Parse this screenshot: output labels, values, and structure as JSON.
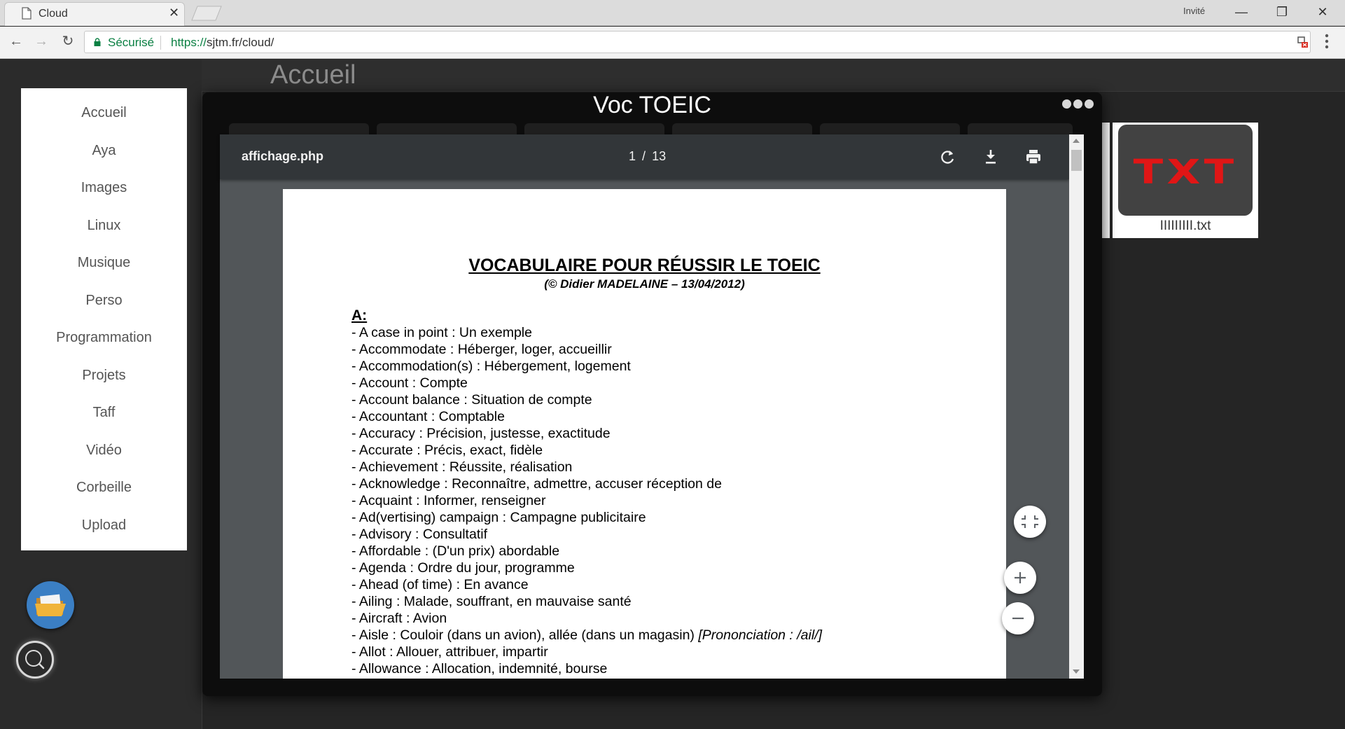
{
  "browser": {
    "tab_title": "Cloud",
    "profile_label": "Invité",
    "secure_label": "Sécurisé",
    "url_scheme": "https://",
    "url_rest": "sjtm.fr/cloud/"
  },
  "page": {
    "title": "Accueil"
  },
  "sidebar": {
    "items": [
      {
        "label": "Accueil"
      },
      {
        "label": "Aya"
      },
      {
        "label": "Images"
      },
      {
        "label": "Linux"
      },
      {
        "label": "Musique"
      },
      {
        "label": "Perso"
      },
      {
        "label": "Programmation"
      },
      {
        "label": "Projets"
      },
      {
        "label": "Taff"
      },
      {
        "label": "Vidéo"
      },
      {
        "label": "Corbeille"
      },
      {
        "label": "Upload"
      }
    ]
  },
  "files": {
    "txt_thumb_label": "TXT",
    "txt_file_name": "IIIIIIIII.txt"
  },
  "modal": {
    "title": "Voc TOEIC"
  },
  "pdf": {
    "filename": "affichage.php",
    "current_page": "1",
    "page_separator": "/",
    "total_pages": "13",
    "doc_title": "VOCABULAIRE POUR RÉUSSIR LE TOEIC",
    "doc_subtitle": "(© Didier MADELAINE – 13/04/2012)",
    "section": "A:",
    "entries": [
      "- A case in point : Un exemple",
      "- Accommodate : Héberger, loger, accueillir",
      "- Accommodation(s) : Hébergement, logement",
      "- Account : Compte",
      "- Account balance : Situation de compte",
      "- Accountant : Comptable",
      "- Accuracy : Précision, justesse, exactitude",
      "- Accurate : Précis, exact, fidèle",
      "- Achievement : Réussite, réalisation",
      "- Acknowledge : Reconnaître, admettre, accuser réception de",
      "- Acquaint : Informer, renseigner",
      "- Ad(vertising) campaign : Campagne publicitaire",
      "- Advisory : Consultatif",
      "- Affordable : (D'un prix) abordable",
      "- Agenda : Ordre du jour, programme",
      "- Ahead (of time) : En avance",
      "- Ailing : Malade, souffrant, en mauvaise santé",
      "- Aircraft : Avion",
      "- Aisle : Couloir (dans un avion), allée (dans un magasin)",
      "- Allot : Allouer, attribuer, impartir",
      "- Allowance : Allocation, indemnité, bourse"
    ],
    "aisle_pronunciation": "[Prononciation : /ail/]"
  },
  "colors": {
    "page_background": "#2b2b2b",
    "secure_green": "#0b8043",
    "txt_red": "#e01616",
    "pdf_toolbar": "#323639",
    "pdf_background": "#525659"
  }
}
